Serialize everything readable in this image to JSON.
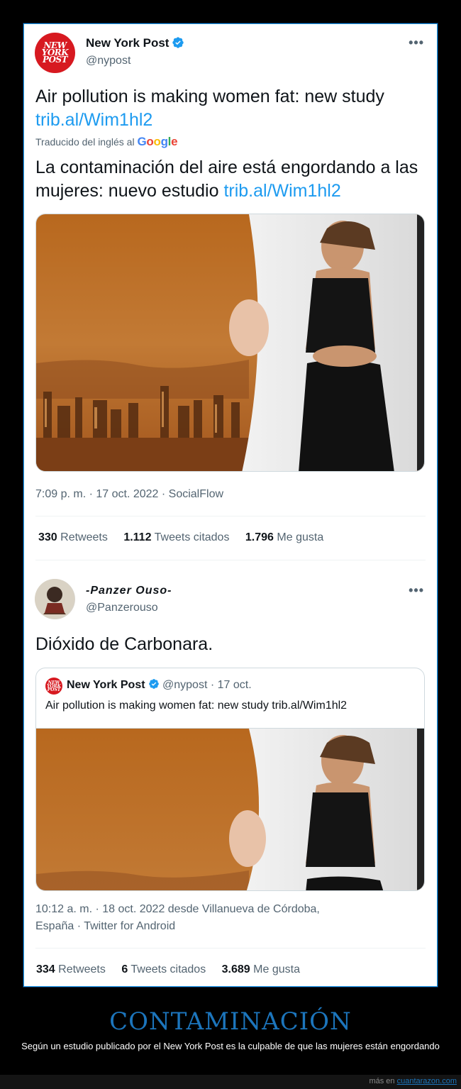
{
  "tweet1": {
    "author_name": "New York Post",
    "author_handle": "@nypost",
    "avatar_text": [
      "NEW",
      "YORK",
      "POST"
    ],
    "text": "Air pollution is making women fat: new study",
    "link": "trib.al/Wim1hl2",
    "translated_label": "Traducido del inglés al",
    "translator": "Google",
    "translation_text": "La contaminación del aire está engordando a las mujeres: nuevo estudio",
    "translation_link": "trib.al/Wim1hl2",
    "timestamp": "7:09 p. m. · 17 oct. 2022 · SocialFlow",
    "retweets_count": "330",
    "retweets_label": "Retweets",
    "quotes_count": "1.112",
    "quotes_label": "Tweets citados",
    "likes_count": "1.796",
    "likes_label": "Me gusta",
    "more_label": "•••"
  },
  "tweet2": {
    "author_name": "-Panzer Ouso-",
    "author_handle": "@Panzerouso",
    "text": "Dióxido de Carbonara.",
    "quote": {
      "author_name": "New York Post",
      "author_handle": "@nypost",
      "date": "· 17 oct.",
      "text": "Air pollution is making women fat: new study trib.al/Wim1hl2"
    },
    "timestamp_line1": "10:12 a. m. · 18 oct. 2022 desde Villanueva de Córdoba,",
    "timestamp_line2": "España · Twitter for Android",
    "retweets_count": "334",
    "retweets_label": "Retweets",
    "quotes_count": "6",
    "quotes_label": "Tweets citados",
    "likes_count": "3.689",
    "likes_label": "Me gusta",
    "more_label": "•••"
  },
  "footer": {
    "title": "CONTAMINACIÓN",
    "subtitle": "Según un estudio publicado por el New York Post es la culpable de que las mujeres están engordando",
    "credit_prefix": "más en",
    "credit_site": "cuantarazon.com"
  },
  "colors": {
    "accent": "#1d9bf0",
    "brand_red": "#d71920",
    "footer_title": "#1c75bc"
  }
}
